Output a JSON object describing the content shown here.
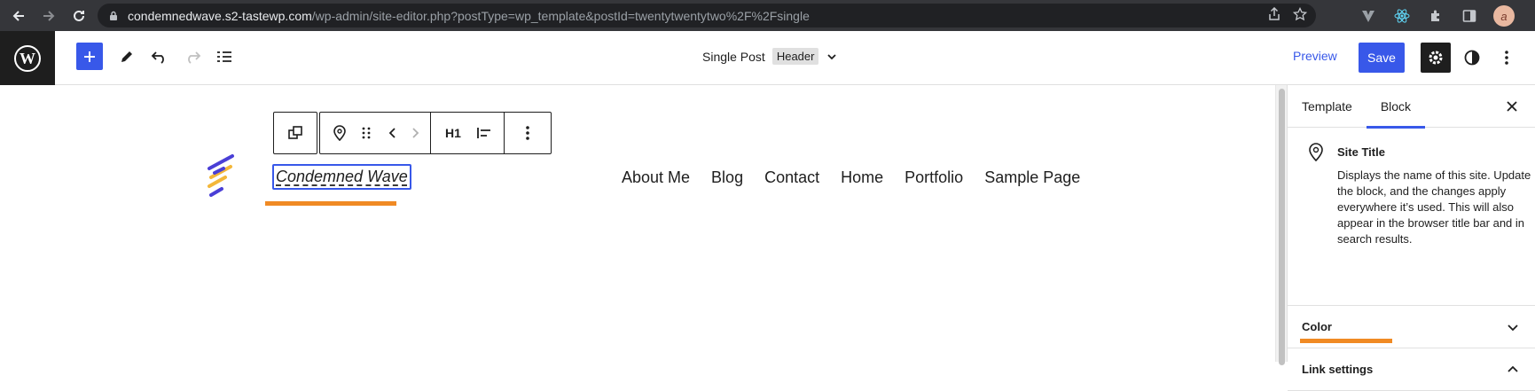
{
  "browser": {
    "url_host": "condemnedwave.s2-tastewp.com",
    "url_path": "/wp-admin/site-editor.php?postType=wp_template&postId=twentytwentytwo%2F%2Fsingle",
    "profile_initial": "a"
  },
  "header": {
    "doc_title": "Single Post",
    "doc_badge": "Header",
    "preview_label": "Preview",
    "save_label": "Save"
  },
  "block_toolbar": {
    "heading_level": "H1"
  },
  "canvas": {
    "site_title": "Condemned Wave",
    "nav_items": [
      "About Me",
      "Blog",
      "Contact",
      "Home",
      "Portfolio",
      "Sample Page"
    ]
  },
  "sidebar": {
    "tabs": [
      "Template",
      "Block"
    ],
    "active_tab": "Block",
    "block_name": "Site Title",
    "block_description": "Displays the name of this site. Update the block, and the changes apply everywhere it’s used. This will also appear in the browser title bar and in search results.",
    "panels": [
      "Color",
      "Link settings"
    ]
  },
  "colors": {
    "accent": "#3858e9",
    "highlight": "#f08a24",
    "chrome_bg": "#35363a"
  }
}
